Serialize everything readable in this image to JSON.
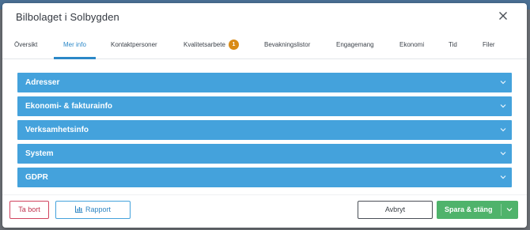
{
  "dialog": {
    "title": "Bilbolaget i Solbygden"
  },
  "tabs": [
    {
      "label": "Översikt",
      "active": false
    },
    {
      "label": "Mer info",
      "active": true
    },
    {
      "label": "Kontaktpersoner",
      "active": false
    },
    {
      "label": "Kvalitetsarbete",
      "active": false,
      "badge": "1"
    },
    {
      "label": "Bevakningslistor",
      "active": false
    },
    {
      "label": "Engagemang",
      "active": false
    },
    {
      "label": "Ekonomi",
      "active": false
    },
    {
      "label": "Tid",
      "active": false
    },
    {
      "label": "Filer",
      "active": false
    }
  ],
  "sections": [
    {
      "label": "Adresser"
    },
    {
      "label": "Ekonomi- & fakturainfo"
    },
    {
      "label": "Verksamhetsinfo"
    },
    {
      "label": "System"
    },
    {
      "label": "GDPR"
    }
  ],
  "footer": {
    "delete_label": "Ta bort",
    "report_label": "Rapport",
    "cancel_label": "Avbryt",
    "save_label": "Spara & stäng"
  },
  "colors": {
    "accent": "#44a2dc",
    "badge": "#d98b16",
    "danger": "#d0435e",
    "success": "#4fb36b"
  },
  "icons": {
    "close": "close-icon",
    "chevron": "chevron-down-icon",
    "report": "bar-chart-icon"
  }
}
